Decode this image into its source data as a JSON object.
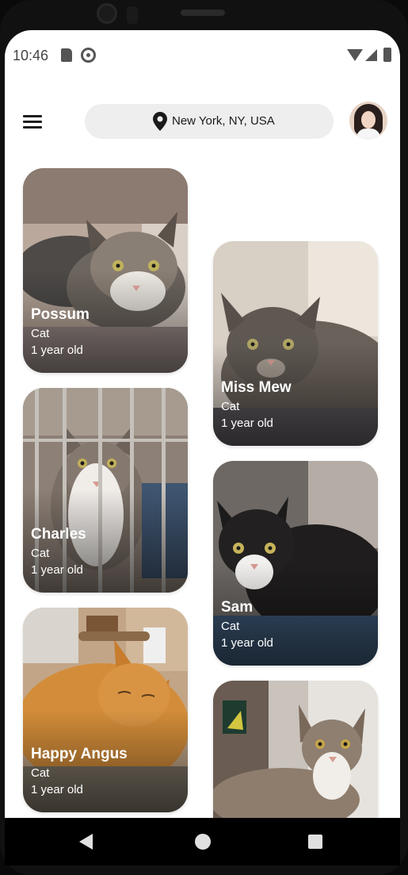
{
  "status_bar": {
    "time": "10:46",
    "icons": [
      "sd-card-icon",
      "sync-icon",
      "wifi-icon",
      "signal-icon",
      "battery-icon"
    ]
  },
  "app_bar": {
    "menu_icon": "menu-icon",
    "location": "New York, NY, USA",
    "location_icon": "location-pin-icon",
    "avatar_icon": "profile-avatar"
  },
  "pets": [
    {
      "name": "Possum",
      "species": "Cat",
      "age": "1 year old"
    },
    {
      "name": "Miss Mew",
      "species": "Cat",
      "age": "1 year old"
    },
    {
      "name": "Charles",
      "species": "Cat",
      "age": "1 year old"
    },
    {
      "name": "Sam",
      "species": "Cat",
      "age": "1 year old"
    },
    {
      "name": "Happy Angus",
      "species": "Cat",
      "age": "1 year old"
    },
    {
      "name": "",
      "species": "",
      "age": ""
    }
  ],
  "nav_bar": {
    "icons": [
      "back-icon",
      "home-icon",
      "recent-apps-icon"
    ]
  },
  "colors": {
    "screen_background": "#ffffff",
    "pill_background": "#eeeeee",
    "text_dark": "#1a1a1a",
    "card_text": "#ffffff"
  }
}
